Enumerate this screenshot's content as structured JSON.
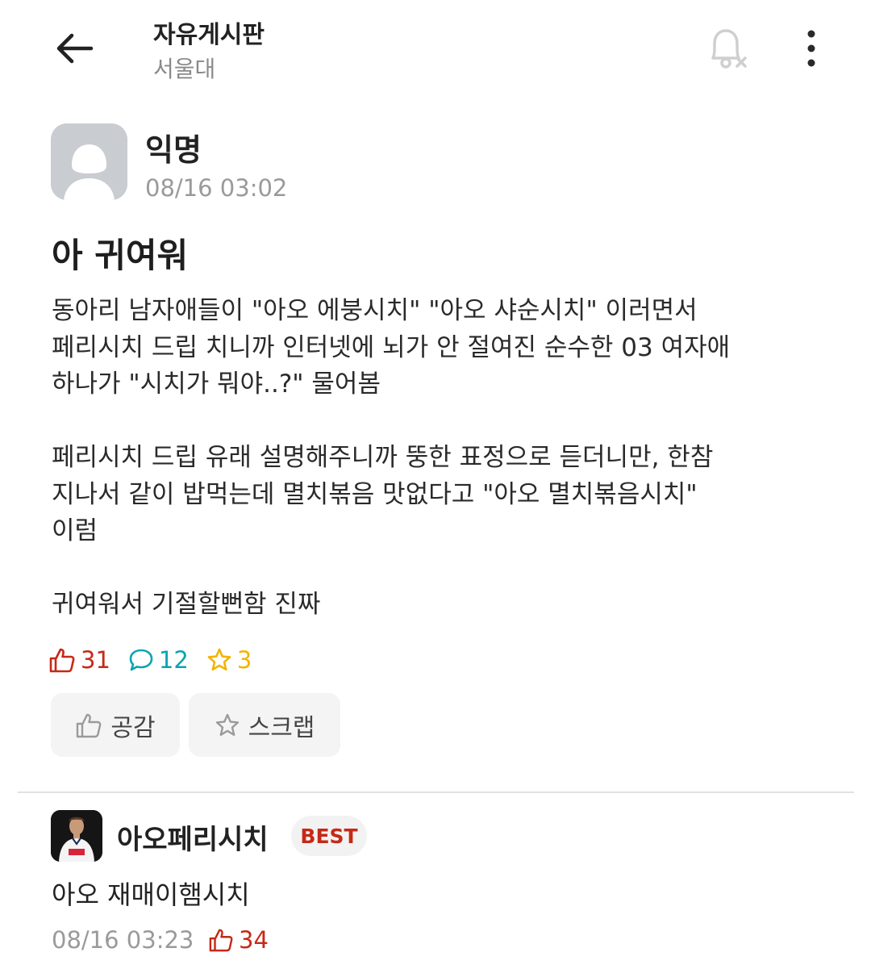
{
  "header": {
    "board_title": "자유게시판",
    "school": "서울대"
  },
  "icons": {
    "back": "arrow-left-icon",
    "bell": "bell-off-icon",
    "more": "more-vertical-icon",
    "like": "thumbs-up-icon",
    "comment": "speech-bubble-icon",
    "scrap": "star-icon"
  },
  "post": {
    "author": "익명",
    "time": "08/16 03:02",
    "title": "아 귀여워",
    "body": [
      "동아리 남자애들이 \"아오 에붕시치\" \"아오 샤순시치\" 이러면서",
      "페리시치 드립 치니까 인터넷에 뇌가 안 절여진 순수한 03 여자애",
      "하나가 \"시치가 뭐야..?\" 물어봄",
      "",
      "페리시치 드립 유래 설명해주니까 뚱한 표정으로 듣더니만, 한참",
      "지나서 같이 밥먹는데 멸치볶음 맛없다고 \"아오 멸치볶음시치\"",
      "이럼",
      "",
      "귀여워서 기절할뻔함 진짜"
    ],
    "stats": {
      "likes": "31",
      "comments": "12",
      "scraps": "3"
    },
    "buttons": {
      "like_label": "공감",
      "scrap_label": "스크랩"
    }
  },
  "comment": {
    "author": "아오페리시치",
    "badge": "BEST",
    "text": "아오 재매이햄시치",
    "time": "08/16 03:23",
    "likes": "34"
  },
  "colors": {
    "like_red": "#c62917",
    "comment_teal": "#0aa4b3",
    "scrap_yellow": "#f2b400",
    "muted_gray": "#9a9a9a"
  }
}
